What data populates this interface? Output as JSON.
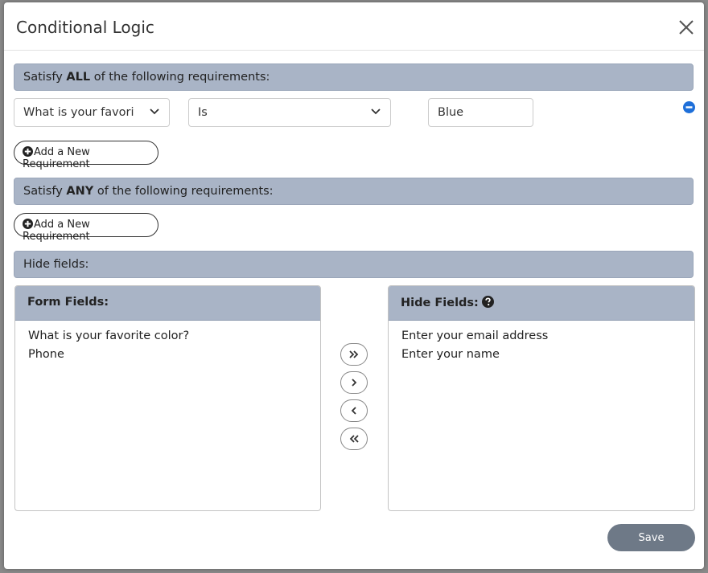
{
  "modal": {
    "title": "Conditional Logic",
    "close_icon": "close-icon"
  },
  "all_section": {
    "prefix": "Satisfy ",
    "emphasis": "ALL",
    "suffix": " of the following requirements:",
    "requirement": {
      "field_value": "What is your favorite color?",
      "operator_value": "Is",
      "value": "Blue"
    },
    "add_button": "Add a New Requirement"
  },
  "any_section": {
    "prefix": "Satisfy ",
    "emphasis": "ANY",
    "suffix": " of the following requirements:",
    "add_button": "Add a New Requirement"
  },
  "hide_section": {
    "title": "Hide fields:"
  },
  "form_fields": {
    "title": "Form Fields:",
    "items": [
      "What is your favorite color?",
      "Phone"
    ]
  },
  "hide_fields": {
    "title": "Hide Fields:",
    "items": [
      "Enter your email address",
      "Enter your name"
    ]
  },
  "move_buttons": [
    "move-all-right-icon",
    "move-right-icon",
    "move-left-icon",
    "move-all-left-icon"
  ],
  "footer": {
    "save_label": "Save"
  },
  "colors": {
    "section_bar": "#a9b4c6",
    "save_button": "#6e7987",
    "remove_icon": "#1e6fd9"
  }
}
